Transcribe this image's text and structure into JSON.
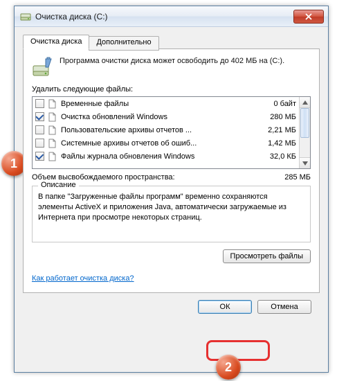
{
  "window": {
    "title": "Очистка диска (C:)"
  },
  "tabs": {
    "main": "Очистка диска",
    "advanced": "Дополнительно"
  },
  "intro_text": "Программа очистки диска может освободить до 402 МБ на (C:).",
  "delete_label": "Удалить следующие файлы:",
  "items": [
    {
      "label": "Временные файлы",
      "size": "0 байт",
      "checked": false
    },
    {
      "label": "Очистка обновлений Windows",
      "size": "280 МБ",
      "checked": true
    },
    {
      "label": "Пользовательские архивы отчетов ...",
      "size": "2,21 МБ",
      "checked": false
    },
    {
      "label": "Системные архивы отчетов об ошиб...",
      "size": "1,42 МБ",
      "checked": false
    },
    {
      "label": "Файлы журнала обновления Windows",
      "size": "32,0 КБ",
      "checked": true
    }
  ],
  "total": {
    "label": "Объем высвобождаемого пространства:",
    "value": "285 МБ"
  },
  "description": {
    "title": "Описание",
    "body": "В папке \"Загруженные файлы программ\" временно сохраняются элементы ActiveX и приложения Java, автоматически загружаемые из Интернета при просмотре некоторых страниц."
  },
  "buttons": {
    "view_files": "Просмотреть файлы",
    "ok": "ОК",
    "cancel": "Отмена"
  },
  "help_link": "Как работает очистка диска?",
  "markers": {
    "one": "1",
    "two": "2"
  }
}
